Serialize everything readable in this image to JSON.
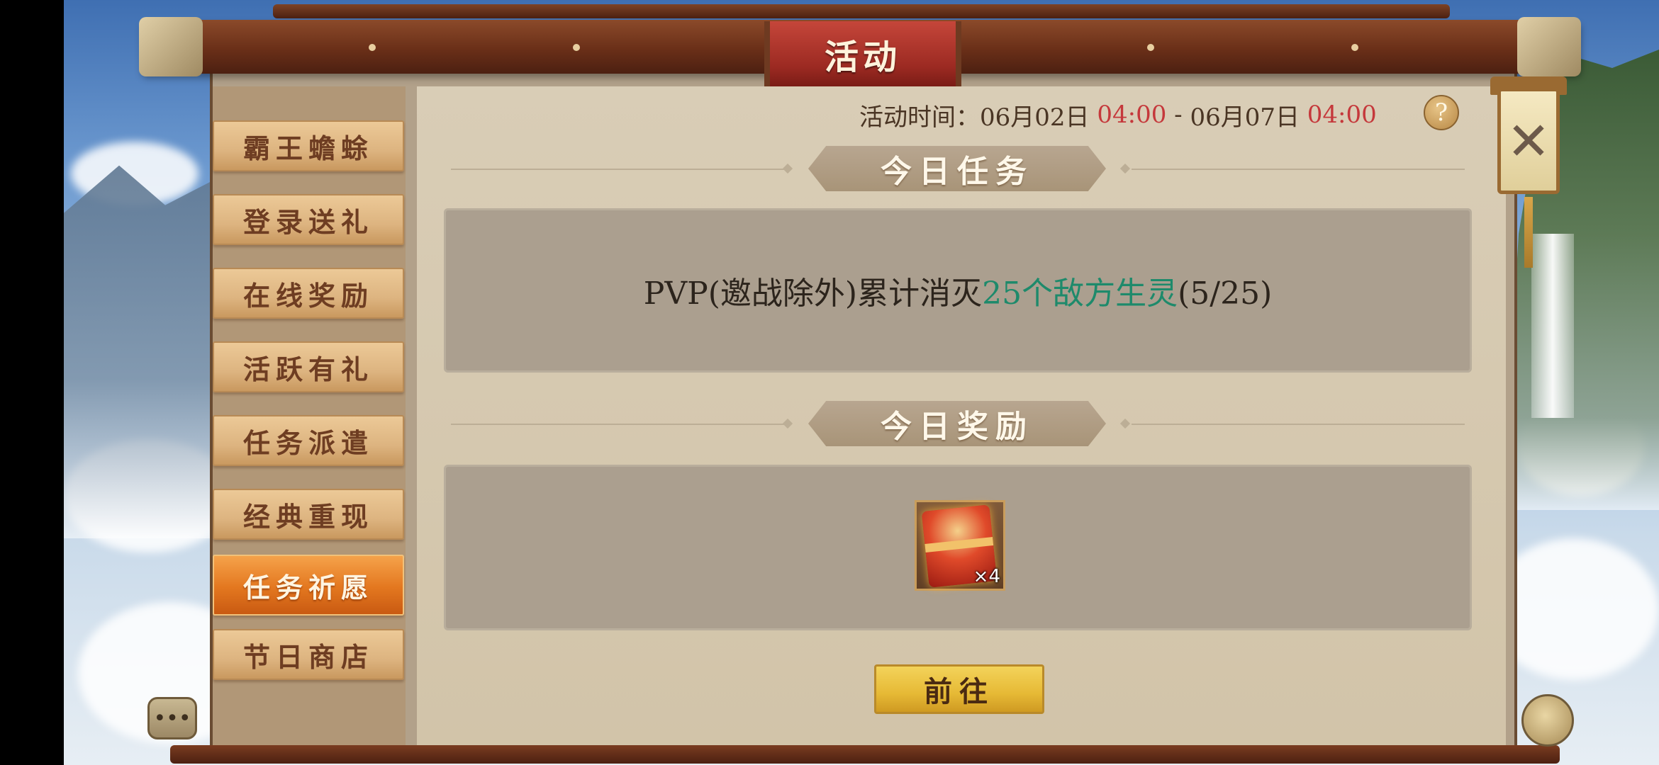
{
  "window": {
    "title": "活动"
  },
  "header": {
    "time_label": "活动时间：",
    "start_date": "06月02日",
    "start_time": "04:00",
    "separator": " - ",
    "end_date": "06月07日",
    "end_time": "04:00",
    "help_label": "?"
  },
  "sidebar": {
    "items": [
      {
        "label": "霸王蟾蜍",
        "active": false
      },
      {
        "label": "登录送礼",
        "active": false
      },
      {
        "label": "在线奖励",
        "active": false
      },
      {
        "label": "活跃有礼",
        "active": false
      },
      {
        "label": "任务派遣",
        "active": false
      },
      {
        "label": "经典重现",
        "active": false
      },
      {
        "label": "任务祈愿",
        "active": true
      },
      {
        "label": "节日商店",
        "active": false
      }
    ]
  },
  "task_section": {
    "title": "今日任务",
    "text_prefix": "PVP(邀战除外)累计消灭",
    "text_highlight": "25个敌方生灵",
    "text_progress": "(5/25)"
  },
  "reward_section": {
    "title": "今日奖励",
    "items": [
      {
        "icon": "red-envelope-icon",
        "count_label": "×4"
      }
    ]
  },
  "actions": {
    "go_label": "前往",
    "close_label": "✕",
    "chat_label": "•••"
  },
  "colors": {
    "accent_red": "#c5383b",
    "highlight_green": "#1e8a6b",
    "active_tab": "#e3771f",
    "button_gold": "#e6b935"
  }
}
